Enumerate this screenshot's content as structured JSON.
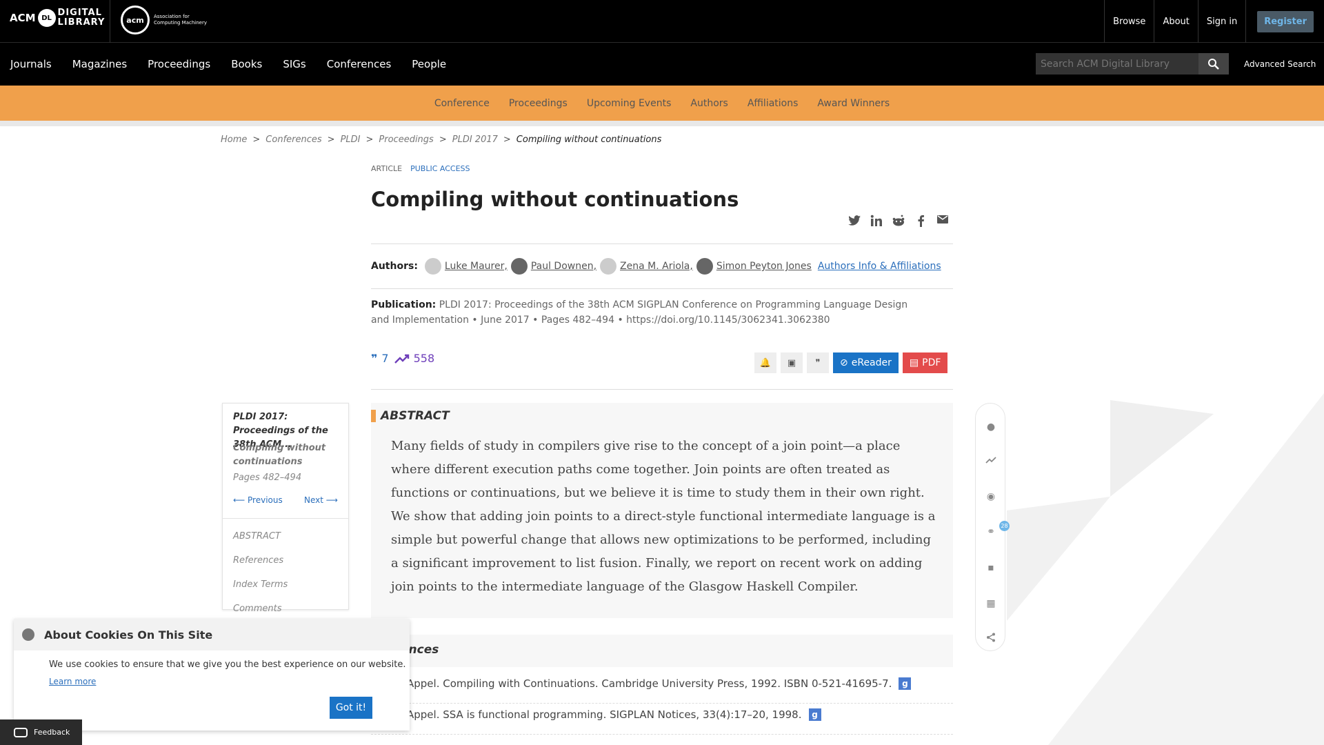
{
  "topbar": {
    "logo_acm": "ACM",
    "logo_dl": "DL",
    "logo_digital": "DIGITAL",
    "logo_library": "LIBRARY",
    "acm_org_logo": "acm",
    "acm_org_name_1": "Association for",
    "acm_org_name_2": "Computing Machinery",
    "browse": "Browse",
    "about": "About",
    "sign_in": "Sign in",
    "register": "Register"
  },
  "nav": {
    "items": [
      "Journals",
      "Magazines",
      "Proceedings",
      "Books",
      "SIGs",
      "Conferences",
      "People"
    ],
    "search_placeholder": "Search ACM Digital Library",
    "advanced_search": "Advanced Search"
  },
  "subnav": {
    "items": [
      "Conference",
      "Proceedings",
      "Upcoming Events",
      "Authors",
      "Affiliations",
      "Award Winners"
    ]
  },
  "breadcrumb": {
    "items": [
      "Home",
      "Conferences",
      "PLDI",
      "Proceedings",
      "PLDI 2017"
    ],
    "current": "Compiling without continuations"
  },
  "article": {
    "type": "ARTICLE",
    "access": "PUBLIC ACCESS",
    "title": "Compiling without continuations",
    "authors_label": "Authors:",
    "authors": [
      "Luke Maurer,",
      "Paul Downen,",
      "Zena M. Ariola,",
      "Simon Peyton Jones"
    ],
    "authors_info": "Authors Info & Affiliations",
    "publication_label": "Publication:",
    "publication": "PLDI 2017: Proceedings of the 38th ACM SIGPLAN Conference on Programming Language Design and Implementation",
    "date": "June 2017",
    "pages": "Pages 482–494",
    "doi": "https://doi.org/10.1145/3062341.3062380",
    "citations": "7",
    "downloads": "558",
    "ereader": "eReader",
    "pdf": "PDF"
  },
  "toc": {
    "conference": "PLDI 2017: Proceedings of the 38th ACM...",
    "article": "Compiling without continuations",
    "pages": "Pages 482–494",
    "previous": "⟵ Previous",
    "next": "Next ⟶",
    "items": [
      "ABSTRACT",
      "References",
      "Index Terms",
      "Comments"
    ]
  },
  "abstract": {
    "heading": "ABSTRACT",
    "text": "Many fields of study in compilers give rise to the concept of a join point—a place where different execution paths come together. Join points are often treated as functions or continuations, but we believe it is time to study them in their own right. We show that adding join points to a direct-style functional intermediate language is a simple but powerful change that allows new optimizations to be performed, including a significant improvement to list fusion. Finally, we report on recent work on adding join points to the intermediate language of the Glasgow Haskell Compiler."
  },
  "references": {
    "heading": "ences",
    "items": [
      "Appel. Compiling with Continuations. Cambridge University Press, 1992. ISBN 0-521-41695-7.",
      "Appel. SSA is functional programming. SIGPLAN Notices, 33(4):17–20, 1998."
    ]
  },
  "rail": {
    "badge": "28"
  },
  "cookie": {
    "title": "About Cookies On This Site",
    "text": "We use cookies to ensure that we give you the best experience on our website.",
    "learn_more": "Learn more",
    "button": "Got it!"
  },
  "feedback": "Feedback",
  "colors": {
    "orange_bar": "#f0a04b",
    "link_blue": "#2a6ebb",
    "pdf_red": "#e34b4b",
    "ereader_blue": "#1a73c6"
  }
}
